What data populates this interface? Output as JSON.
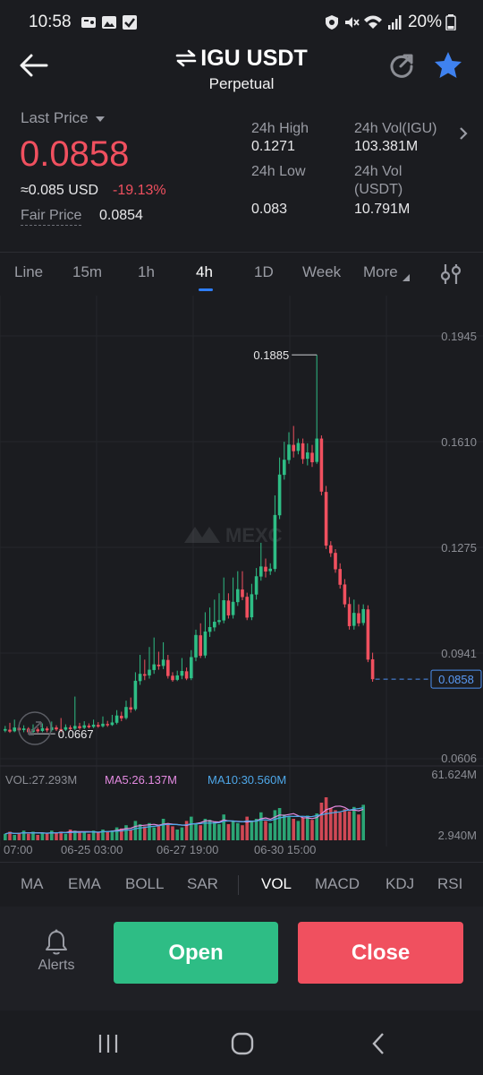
{
  "status_bar": {
    "time": "10:58",
    "battery": "20%",
    "icons": [
      "notification-icon",
      "gallery-icon",
      "check-icon",
      "vpn-icon",
      "mute-icon",
      "wifi-icon",
      "signal-icon",
      "battery-icon"
    ]
  },
  "header": {
    "pair": "IGU USDT",
    "subtitle": "Perpetual",
    "icons": [
      "back-arrow-icon",
      "swap-icon",
      "refresh-icon",
      "star-icon"
    ],
    "star_color": "#3f82f0"
  },
  "stats": {
    "last_price_label": "Last Price",
    "last_price": "0.0858",
    "usd_value": "≈0.085 USD",
    "change_pct": "-19.13%",
    "fair_price_label": "Fair Price",
    "fair_price": "0.0854",
    "high_label": "24h High",
    "high": "0.1271",
    "low_label": "24h Low",
    "low": "0.083",
    "vol_igu_label": "24h Vol(IGU)",
    "vol_igu": "103.381M",
    "vol_usdt_label_1": "24h Vol",
    "vol_usdt_label_2": "(USDT)",
    "vol_usdt": "10.791M",
    "down_color": "#f0505f",
    "up_color": "#2ebd85"
  },
  "tabs": {
    "items": [
      "Line",
      "15m",
      "1h",
      "4h",
      "1D",
      "Week",
      "More"
    ],
    "active": "4h"
  },
  "chart_data": {
    "type": "candlestick",
    "watermark": "MEXC",
    "price_axis_ticks": [
      "0.1945",
      "0.1610",
      "0.1275",
      "0.0941",
      "0.0606"
    ],
    "ylim": [
      0.0606,
      0.1945
    ],
    "max_marker": "0.1885",
    "min_marker": "0.0667",
    "current_price_tag": "0.0858",
    "candles": [
      [
        0.0695,
        0.07,
        0.069,
        0.071
      ],
      [
        0.0698,
        0.0692,
        0.0688,
        0.072
      ],
      [
        0.0693,
        0.0705,
        0.069,
        0.073
      ],
      [
        0.0704,
        0.0696,
        0.0692,
        0.0712
      ],
      [
        0.0697,
        0.0702,
        0.069,
        0.0712
      ],
      [
        0.0701,
        0.069,
        0.0685,
        0.0706
      ],
      [
        0.0691,
        0.07,
        0.0688,
        0.0715
      ],
      [
        0.0699,
        0.0693,
        0.0688,
        0.0705
      ],
      [
        0.0694,
        0.0703,
        0.069,
        0.0718
      ],
      [
        0.0702,
        0.0696,
        0.069,
        0.0708
      ],
      [
        0.0697,
        0.0706,
        0.0692,
        0.0724
      ],
      [
        0.0705,
        0.0699,
        0.0694,
        0.0712
      ],
      [
        0.07,
        0.0697,
        0.069,
        0.0735
      ],
      [
        0.0698,
        0.0706,
        0.0694,
        0.0715
      ],
      [
        0.0705,
        0.07,
        0.0696,
        0.0712
      ],
      [
        0.0701,
        0.071,
        0.0697,
        0.0803
      ],
      [
        0.0709,
        0.0703,
        0.0698,
        0.072
      ],
      [
        0.0704,
        0.0712,
        0.07,
        0.0725
      ],
      [
        0.0711,
        0.0706,
        0.0702,
        0.0718
      ],
      [
        0.0707,
        0.0714,
        0.0703,
        0.073
      ],
      [
        0.0713,
        0.0708,
        0.0704,
        0.0722
      ],
      [
        0.0709,
        0.0717,
        0.0705,
        0.074
      ],
      [
        0.0716,
        0.0712,
        0.0707,
        0.0726
      ],
      [
        0.0713,
        0.0721,
        0.071,
        0.0745
      ],
      [
        0.072,
        0.0743,
        0.0715,
        0.076
      ],
      [
        0.0742,
        0.0734,
        0.0725,
        0.0755
      ],
      [
        0.0735,
        0.077,
        0.073,
        0.079
      ],
      [
        0.0769,
        0.0762,
        0.0752,
        0.08
      ],
      [
        0.0763,
        0.0853,
        0.0758,
        0.088
      ],
      [
        0.0852,
        0.0875,
        0.084,
        0.0935
      ],
      [
        0.0874,
        0.0869,
        0.0855,
        0.092
      ],
      [
        0.087,
        0.0888,
        0.086,
        0.096
      ],
      [
        0.0887,
        0.0905,
        0.0875,
        0.099
      ],
      [
        0.0904,
        0.0899,
        0.0888,
        0.0945
      ],
      [
        0.09,
        0.092,
        0.089,
        0.0975
      ],
      [
        0.0919,
        0.0868,
        0.086,
        0.0935
      ],
      [
        0.0869,
        0.0855,
        0.085,
        0.088
      ],
      [
        0.0856,
        0.087,
        0.0852,
        0.0885
      ],
      [
        0.0869,
        0.0884,
        0.0858,
        0.0925
      ],
      [
        0.0883,
        0.086,
        0.0855,
        0.0895
      ],
      [
        0.0861,
        0.0928,
        0.0855,
        0.095
      ],
      [
        0.0927,
        0.0998,
        0.0915,
        0.1015
      ],
      [
        0.0997,
        0.0932,
        0.0925,
        0.1035
      ],
      [
        0.0933,
        0.1009,
        0.0925,
        0.107
      ],
      [
        0.1008,
        0.1023,
        0.0992,
        0.1085
      ],
      [
        0.1022,
        0.104,
        0.101,
        0.111
      ],
      [
        0.1039,
        0.1045,
        0.103,
        0.113
      ],
      [
        0.1044,
        0.1108,
        0.1035,
        0.118
      ],
      [
        0.1107,
        0.106,
        0.105,
        0.113
      ],
      [
        0.1061,
        0.1103,
        0.105,
        0.118
      ],
      [
        0.1102,
        0.1143,
        0.109,
        0.12
      ],
      [
        0.1142,
        0.1118,
        0.1108,
        0.12
      ],
      [
        0.1119,
        0.1053,
        0.1045,
        0.1132
      ],
      [
        0.1054,
        0.1127,
        0.1045,
        0.116
      ],
      [
        0.1126,
        0.1184,
        0.111,
        0.121
      ],
      [
        0.1183,
        0.1215,
        0.117,
        0.129
      ],
      [
        0.1214,
        0.1199,
        0.118,
        0.124
      ],
      [
        0.12,
        0.1208,
        0.1188,
        0.1225
      ],
      [
        0.1207,
        0.1378,
        0.1198,
        0.144
      ],
      [
        0.1377,
        0.1506,
        0.1365,
        0.156
      ],
      [
        0.1505,
        0.1553,
        0.149,
        0.161
      ],
      [
        0.1552,
        0.1601,
        0.154,
        0.164
      ],
      [
        0.16,
        0.158,
        0.156,
        0.166
      ],
      [
        0.1581,
        0.1606,
        0.157,
        0.162
      ],
      [
        0.1605,
        0.1555,
        0.154,
        0.162
      ],
      [
        0.1556,
        0.1576,
        0.1535,
        0.1605
      ],
      [
        0.1575,
        0.1545,
        0.153,
        0.16
      ],
      [
        0.1546,
        0.162,
        0.154,
        0.1885
      ],
      [
        0.162,
        0.1452,
        0.144,
        0.163
      ],
      [
        0.1451,
        0.1281,
        0.127,
        0.147
      ],
      [
        0.1282,
        0.1257,
        0.1245,
        0.1295
      ],
      [
        0.1258,
        0.1206,
        0.1195,
        0.127
      ],
      [
        0.1207,
        0.1157,
        0.1145,
        0.1225
      ],
      [
        0.1158,
        0.1095,
        0.1085,
        0.1175
      ],
      [
        0.1096,
        0.1026,
        0.1015,
        0.1118
      ],
      [
        0.1027,
        0.1068,
        0.1015,
        0.111
      ],
      [
        0.1067,
        0.1035,
        0.1025,
        0.1095
      ],
      [
        0.1036,
        0.108,
        0.1028,
        0.1095
      ],
      [
        0.1079,
        0.092,
        0.0912,
        0.1092
      ],
      [
        0.0921,
        0.0858,
        0.085,
        0.0942
      ]
    ]
  },
  "volume": {
    "vol_label": "VOL:27.293M",
    "ma5_label": "MA5:26.137M",
    "ma10_label": "MA10:30.560M",
    "ma5_color": "#e38ae0",
    "ma10_color": "#4ea7e8",
    "axis_top": "61.624M",
    "axis_bottom": "2.940M",
    "time_ticks": [
      "07:00",
      "06-25 03:00",
      "06-27 19:00",
      "06-30 15:00"
    ],
    "bars": [
      6,
      8,
      5,
      7,
      9,
      6,
      8,
      5,
      7,
      6,
      9,
      7,
      8,
      6,
      10,
      9,
      7,
      8,
      6,
      9,
      7,
      10,
      8,
      9,
      12,
      11,
      14,
      10,
      18,
      15,
      13,
      16,
      12,
      14,
      20,
      16,
      13,
      10,
      12,
      18,
      22,
      16,
      14,
      20,
      19,
      17,
      15,
      24,
      15,
      18,
      16,
      14,
      22,
      18,
      20,
      26,
      18,
      16,
      28,
      30,
      24,
      22,
      20,
      18,
      21,
      23,
      19,
      25,
      35,
      40,
      30,
      28,
      26,
      29,
      27,
      31,
      24,
      33
    ]
  },
  "indicators": {
    "items": [
      "MA",
      "EMA",
      "BOLL",
      "SAR",
      "VOL",
      "MACD",
      "KDJ",
      "RSI"
    ],
    "active": "VOL"
  },
  "actions": {
    "alerts_label": "Alerts",
    "open_label": "Open",
    "close_label": "Close"
  },
  "nav": {
    "icons": [
      "recent-apps-icon",
      "home-icon",
      "back-icon"
    ]
  }
}
